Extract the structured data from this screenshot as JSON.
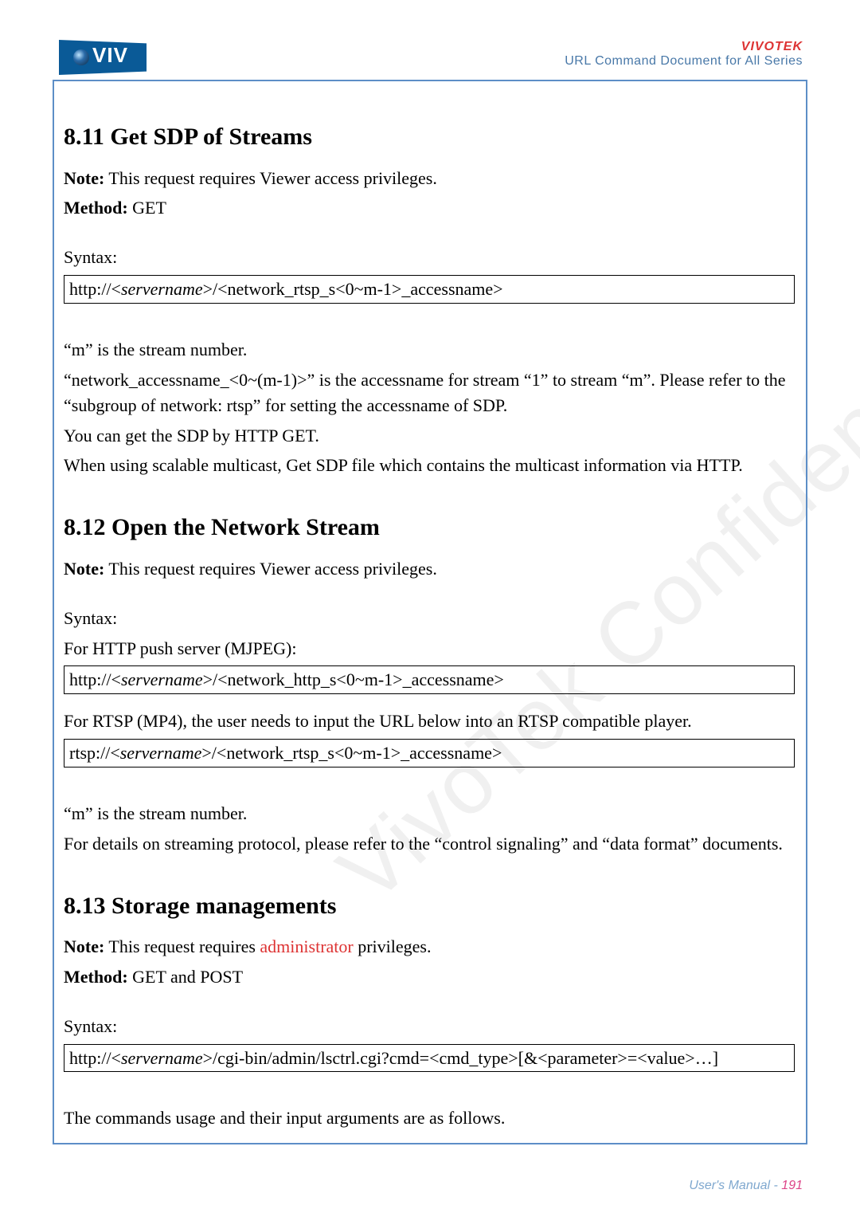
{
  "header": {
    "brand": "VIVOTEK",
    "subtitle": "URL Command Document for All Series",
    "logo_text": "VIV"
  },
  "watermark": "VivoTek Confidential",
  "sections": {
    "s811": {
      "heading": "8.11 Get SDP of Streams",
      "note_label": "Note:",
      "note_text": " This request requires Viewer access privileges.",
      "method_label": "Method:",
      "method_text": " GET",
      "syntax_label": "Syntax:",
      "syntax_pre": "http://<",
      "syntax_srv": "servername",
      "syntax_post": ">/<network_rtsp_s<0~m-1>_accessname>",
      "p1": "“m” is the stream number.",
      "p2": "“network_accessname_<0~(m-1)>” is the accessname for stream “1” to stream “m”. Please refer to the “subgroup of network: rtsp” for setting the accessname of SDP.",
      "p3": "You can get the SDP by HTTP GET.",
      "p4": "When using scalable multicast, Get SDP file which contains the multicast information via HTTP."
    },
    "s812": {
      "heading": "8.12 Open the Network Stream",
      "note_label": "Note:",
      "note_text": " This request requires Viewer access privileges.",
      "syntax_label": "Syntax:",
      "p_http": "For HTTP push server (MJPEG):",
      "http_pre": "http://<",
      "http_srv": "servername",
      "http_post": ">/<network_http_s<0~m-1>_accessname>",
      "p_rtsp": "For RTSP (MP4), the user needs to input the URL below into an RTSP compatible player.",
      "rtsp_pre": "rtsp://<",
      "rtsp_srv": "servername",
      "rtsp_post": ">/<network_rtsp_s<0~m-1>_accessname>",
      "p1": "“m” is the stream number.",
      "p2": "For details on streaming protocol, please refer to the “control signaling” and “data format” documents."
    },
    "s813": {
      "heading": "8.13 Storage managements",
      "note_label": "Note:",
      "note_text_pre": " This request requires ",
      "admin_word": "administrator",
      "note_text_post": " privileges.",
      "method_label": "Method:",
      "method_text": " GET and POST",
      "syntax_label": "Syntax:",
      "syntax_pre": "http://<",
      "syntax_srv": "servername",
      "syntax_post": ">/cgi-bin/admin/lsctrl.cgi?cmd=<cmd_type>[&<parameter>=<value>…]",
      "p1": "The commands usage and their input arguments are as follows."
    }
  },
  "footer": {
    "label": "User's Manual - ",
    "page": "191"
  }
}
